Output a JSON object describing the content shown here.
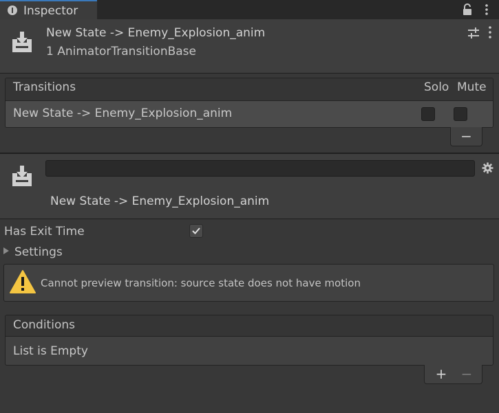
{
  "window": {
    "tab_label": "Inspector",
    "icons": {
      "tab": "info-icon",
      "lock": "lock-icon",
      "menu": "kebab-menu-icon"
    }
  },
  "header": {
    "title": "New State -> Enemy_Explosion_anim",
    "subtitle": "1 AnimatorTransitionBase",
    "icons": {
      "object": "transition-import-icon",
      "preset": "preset-sliders-icon",
      "menu": "kebab-menu-icon"
    }
  },
  "transitions": {
    "title": "Transitions",
    "columns": {
      "solo": "Solo",
      "mute": "Mute"
    },
    "rows": [
      {
        "label": "New State -> Enemy_Explosion_anim",
        "solo": false,
        "mute": false
      }
    ],
    "remove_label": "−"
  },
  "transition": {
    "name_field_value": "",
    "name": "New State -> Enemy_Explosion_anim",
    "icons": {
      "object": "transition-import-icon",
      "settings": "gear-icon"
    }
  },
  "settings": {
    "has_exit_time_label": "Has Exit Time",
    "has_exit_time": true,
    "settings_label": "Settings"
  },
  "warning": {
    "text": "Cannot preview transition: source state does not have motion",
    "icon": "warning-icon",
    "color": "#f4c542"
  },
  "conditions": {
    "title": "Conditions",
    "empty_text": "List is Empty",
    "add_label": "+",
    "remove_label": "−"
  },
  "colors": {
    "background": "#383838",
    "accent": "#3a79bb",
    "text": "#c4c4c4"
  }
}
